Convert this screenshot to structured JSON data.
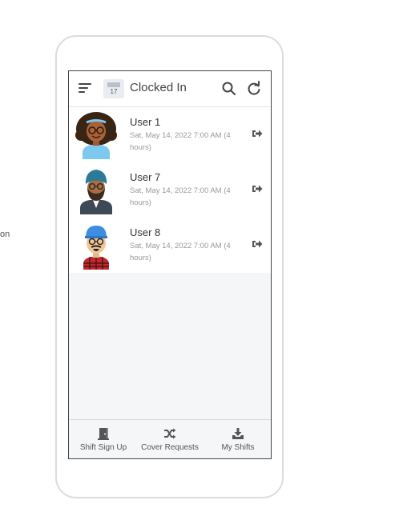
{
  "background_text": "on",
  "header": {
    "calendar_day": "17",
    "title": "Clocked In"
  },
  "users": [
    {
      "name": "User 1",
      "detail": "Sat, May 14, 2022 7:00 AM (4 hours)"
    },
    {
      "name": "User 7",
      "detail": "Sat, May 14, 2022 7:00 AM (4 hours)"
    },
    {
      "name": "User 8",
      "detail": "Sat, May 14, 2022 7:00 AM (4 hours)"
    }
  ],
  "footer": {
    "tabs": [
      {
        "label": "Shift Sign Up",
        "icon": "door-icon"
      },
      {
        "label": "Cover Requests",
        "icon": "shuffle-icon"
      },
      {
        "label": "My Shifts",
        "icon": "download-tray-icon"
      }
    ]
  },
  "colors": {
    "icon": "#555555",
    "subtext": "#999999",
    "screen_bg": "#f5f6f8"
  }
}
